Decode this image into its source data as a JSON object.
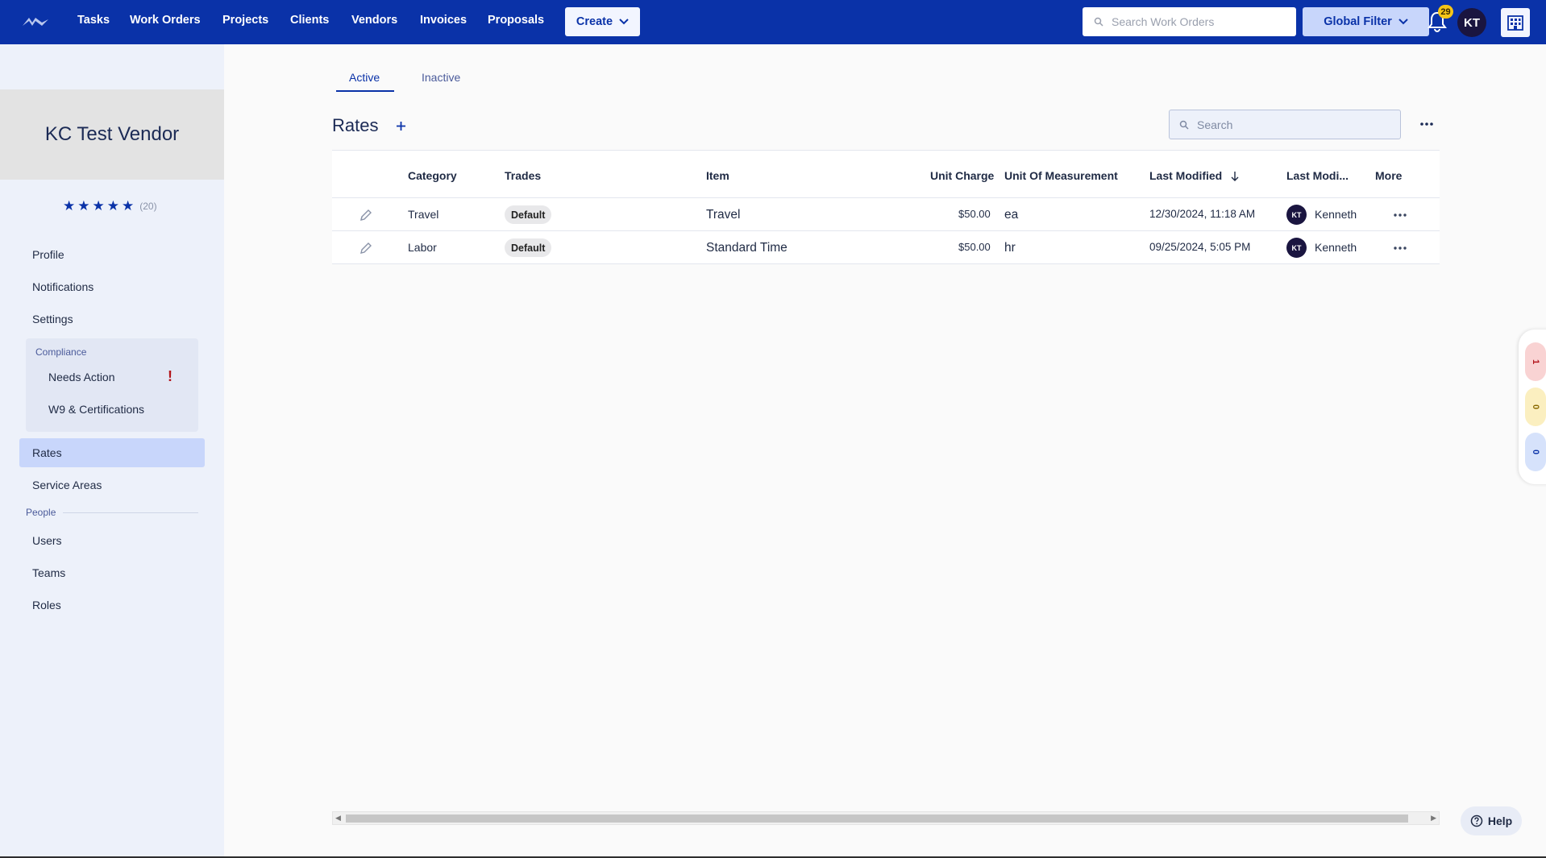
{
  "nav": {
    "items": [
      "Tasks",
      "Work Orders",
      "Projects",
      "Clients",
      "Vendors",
      "Invoices",
      "Proposals"
    ],
    "create_label": "Create",
    "search_placeholder": "Search Work Orders",
    "global_filter_label": "Global Filter",
    "notification_count": "29",
    "user_initials": "KT",
    "brand_color": "#0a32a8"
  },
  "sidebar": {
    "vendor_name": "KC Test Vendor",
    "rating_stars": 5,
    "rating_count": "(20)",
    "links": {
      "profile": "Profile",
      "notifications": "Notifications",
      "settings": "Settings",
      "compliance_heading": "Compliance",
      "needs_action": "Needs Action",
      "needs_action_alert": "!",
      "w9": "W9 & Certifications",
      "rates": "Rates",
      "service_areas": "Service Areas",
      "people_heading": "People",
      "users": "Users",
      "teams": "Teams",
      "roles": "Roles"
    }
  },
  "main": {
    "tabs": [
      "Active",
      "Inactive"
    ],
    "active_tab": "Active",
    "title": "Rates",
    "search_placeholder": "Search",
    "columns": {
      "category": "Category",
      "trades": "Trades",
      "item": "Item",
      "unit_charge": "Unit Charge",
      "unit_of_measurement": "Unit Of Measurement",
      "last_modified": "Last Modified",
      "last_modified_by": "Last Modi...",
      "more": "More"
    },
    "rows": [
      {
        "category": "Travel",
        "trade": "Default",
        "item": "Travel",
        "unit_charge": "$50.00",
        "uom": "ea",
        "last_modified": "12/30/2024, 11:18 AM",
        "modified_by_initials": "KT",
        "modified_by": "Kenneth"
      },
      {
        "category": "Labor",
        "trade": "Default",
        "item": "Standard Time",
        "unit_charge": "$50.00",
        "uom": "hr",
        "last_modified": "09/25/2024, 5:05 PM",
        "modified_by_initials": "KT",
        "modified_by": "Kenneth"
      }
    ]
  },
  "help_label": "Help",
  "side_widget": {
    "counts": [
      "1",
      "0",
      "0"
    ],
    "colors": [
      "#f9d3d3",
      "#fbefc0",
      "#d6e2fb"
    ]
  }
}
